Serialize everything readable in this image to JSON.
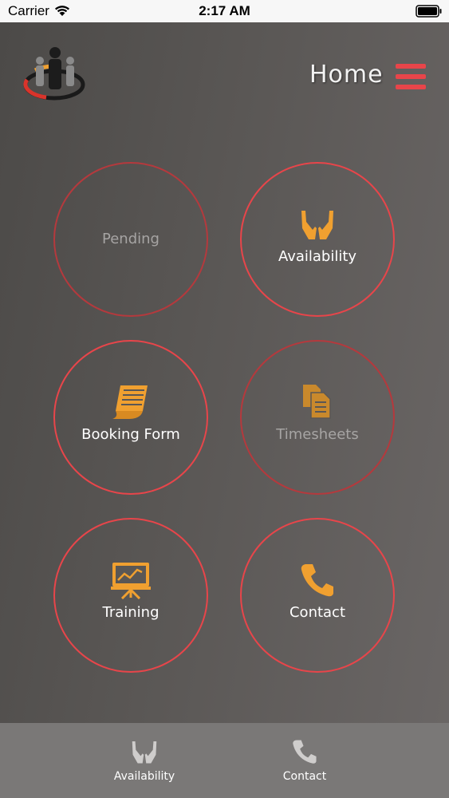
{
  "status_bar": {
    "carrier": "Carrier",
    "time": "2:17 AM"
  },
  "header": {
    "title": "Home",
    "logo_icon": "people-group-logo",
    "menu_icon": "hamburger-menu-icon"
  },
  "tiles": [
    {
      "label": "Pending",
      "icon": "none",
      "state": "dim"
    },
    {
      "label": "Availability",
      "icon": "open-hands-icon",
      "state": "active"
    },
    {
      "label": "Booking Form",
      "icon": "scroll-form-icon",
      "state": "active"
    },
    {
      "label": "Timesheets",
      "icon": "documents-icon",
      "state": "dim"
    },
    {
      "label": "Training",
      "icon": "presentation-board-icon",
      "state": "active"
    },
    {
      "label": "Contact",
      "icon": "phone-icon",
      "state": "active"
    }
  ],
  "tab_bar": {
    "items": [
      {
        "label": "Availability",
        "icon": "open-hands-icon"
      },
      {
        "label": "Contact",
        "icon": "phone-icon"
      }
    ]
  },
  "colors": {
    "accent_red": "#e8454a",
    "icon_orange": "#f0a030",
    "tab_bar": "#7a7877"
  }
}
